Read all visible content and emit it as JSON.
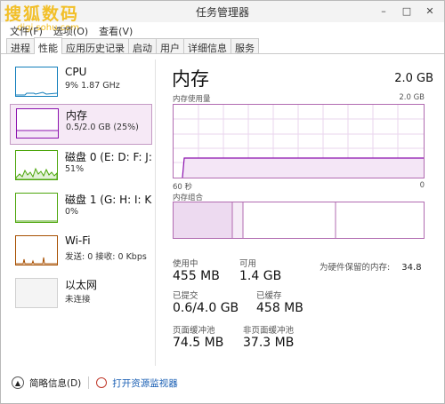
{
  "window": {
    "title": "任务管理器",
    "minimize": "–",
    "maximize": "□",
    "close": "✕"
  },
  "watermark": {
    "text": "搜狐数码",
    "sub": "digi.sohu.com"
  },
  "menu": [
    "文件(F)",
    "选项(O)",
    "查看(V)"
  ],
  "tabs": [
    "进程",
    "性能",
    "应用历史记录",
    "启动",
    "用户",
    "详细信息",
    "服务"
  ],
  "active_tab": "性能",
  "sidebar": {
    "items": [
      {
        "title": "CPU",
        "sub": "9% 1.87 GHz",
        "color": "#117dbb"
      },
      {
        "title": "内存",
        "sub": "0.5/2.0 GB (25%)",
        "color": "#8b12ae"
      },
      {
        "title": "磁盘 0 (E: D: F: J:",
        "sub": "51%",
        "color": "#4da60c"
      },
      {
        "title": "磁盘 1 (G: H: I: K:",
        "sub": "0%",
        "color": "#4da60c"
      },
      {
        "title": "Wi-Fi",
        "sub": "发送: 0 接收: 0 Kbps",
        "color": "#a74f01"
      },
      {
        "title": "以太网",
        "sub": "未连接",
        "color": "#a74f01"
      }
    ],
    "selected_index": 1
  },
  "memory": {
    "title": "内存",
    "capacity": "2.0 GB",
    "usage_label": "内存使用量",
    "usage_max": "2.0 GB",
    "time_left": "60 秒",
    "time_right": "0",
    "composition_label": "内存组合",
    "usage_fraction": 0.25,
    "stats": [
      {
        "key": "使用中",
        "value": "455 MB"
      },
      {
        "key": "可用",
        "value": "1.4 GB"
      },
      {
        "key": "为硬件保留的内存:",
        "value": "34.8"
      },
      {
        "key": "已提交",
        "value": "0.6/4.0 GB"
      },
      {
        "key": "已缓存",
        "value": "458 MB"
      },
      {
        "key": "页面缓冲池",
        "value": "74.5 MB"
      },
      {
        "key": "非页面缓冲池",
        "value": "37.3 MB"
      }
    ]
  },
  "footer": {
    "brief": "简略信息(D)",
    "monitor": "打开资源监视器"
  }
}
